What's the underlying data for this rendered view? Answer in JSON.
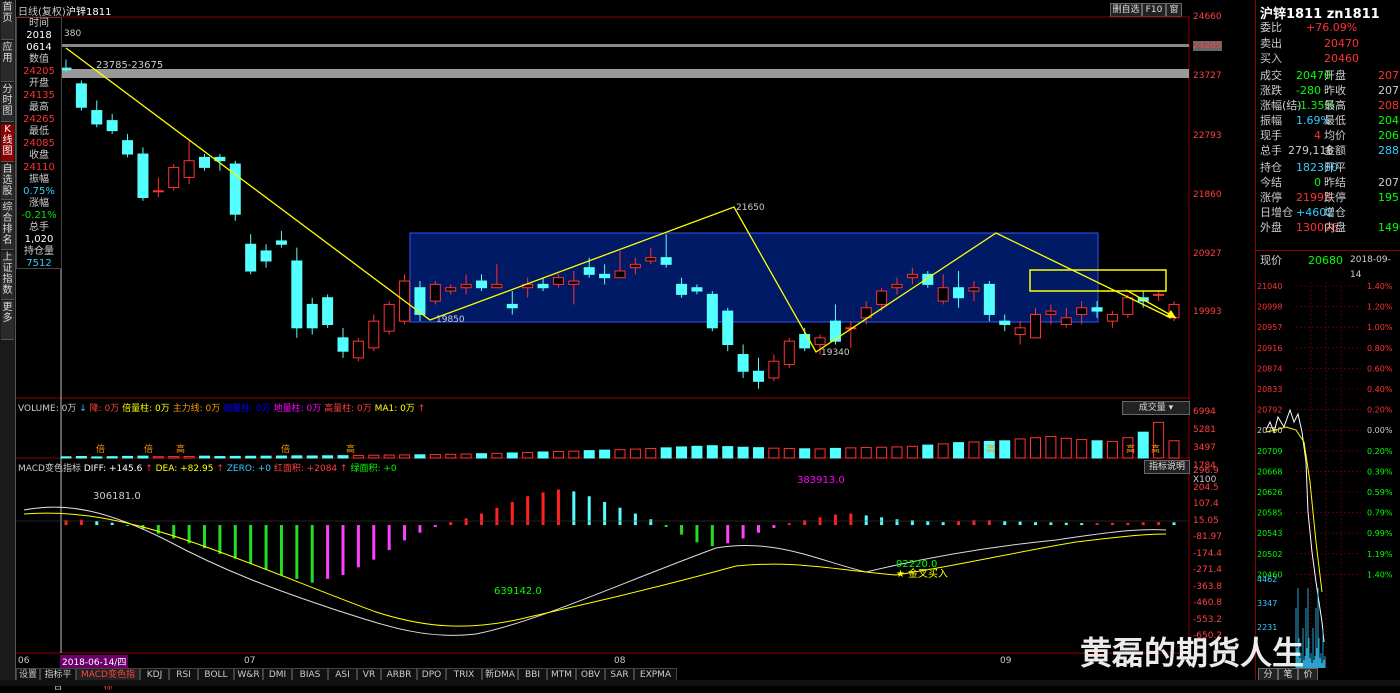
{
  "nav": [
    "首页",
    "应用",
    "分时图",
    "K线图",
    "自选股",
    "综合排名",
    "上证指数",
    "更多"
  ],
  "topbar": {
    "period": "日线(复权)",
    "symbol": "沪锌1811",
    "btn_a": "删自选",
    "btn_b": "F10",
    "btn_c": "窗"
  },
  "infobox": {
    "time_label": "时间",
    "time_value_1": "2018",
    "time_value_2": "0614",
    "val_label": "数值",
    "val_value": "24205",
    "open_label": "开盘",
    "open_value": "24135",
    "high_label": "最高",
    "high_value": "24265",
    "low_label": "最低",
    "low_value": "24085",
    "close_label": "收盘",
    "close_value": "24110",
    "amp_label": "振幅",
    "amp_value": "0.75%",
    "chg_label": "涨幅",
    "chg_value": "-0.21%",
    "vol_label": "总手",
    "vol_value": "1,020",
    "oi_label": "持仓量",
    "oi_value": "7512"
  },
  "annotations": {
    "range": "23785-23675",
    "p19850": "19850",
    "p21650": "21650",
    "p19340": "19340",
    "p380": "380"
  },
  "price_axis": [
    "24660",
    "24205",
    "23727",
    "22793",
    "21860",
    "20927",
    "19993"
  ],
  "volume_axis": [
    "6994",
    "5281",
    "3497",
    "1784",
    "X100"
  ],
  "macd_axis": [
    "296.9",
    "204.5",
    "107.4",
    "15.05",
    "-81.97",
    "-174.4",
    "-271.4",
    "-363.8",
    "-460.8",
    "-553.2",
    "-650.2"
  ],
  "volume_legend": {
    "text": "VOLUME: 0万",
    "a": "降: 0万",
    "b": "倍量柱: 0万",
    "c": "主力线: 0万",
    "d": "缩量柱: 0万",
    "e": "地量柱: 0万",
    "f": "高量柱: 0万",
    "g": "MA1: 0万",
    "selector": "成交量"
  },
  "macd_legend": {
    "name": "MACD变色指标",
    "diff": "DIFF: +145.6",
    "dea": "DEA: +82.95",
    "zero": "ZERO: +0",
    "red_area": "红面积: +2084",
    "green_area": "绿面积: +0",
    "help": "指标说明"
  },
  "macd_annot": {
    "a": "306181.0",
    "b": "383913.0",
    "c": "639142.0",
    "d": "92220.0",
    "cross": "金叉买入"
  },
  "vol_marks": {
    "bei": "倍",
    "gao": "高"
  },
  "xaxis": {
    "m06": "06",
    "date": "2018-06-14/四",
    "m07": "07",
    "m08": "08",
    "m09": "09"
  },
  "tabs": [
    "设置",
    "指标平台",
    "MACD变色指标",
    "KDJ",
    "RSI",
    "BOLL",
    "W&R",
    "DMI",
    "BIAS",
    "ASI",
    "VR",
    "ARBR",
    "DPO",
    "TRIX",
    "新DMA",
    "BBI",
    "MTM",
    "OBV",
    "SAR",
    "EXPMA"
  ],
  "right": {
    "title": "沪锌1811 zn1811",
    "weibi_l": "委比",
    "weibi_v": "+76.09%",
    "sell_l": "卖出",
    "sell_v": "20470",
    "buy_l": "买入",
    "buy_v": "20460",
    "deal_l": "成交",
    "deal_v": "20470",
    "open_l": "开盘",
    "open_v": "207",
    "zd_l": "涨跌",
    "zd_v": "-280",
    "prevc_l": "昨收",
    "prevc_v": "207",
    "zf_l": "涨幅(结)",
    "zf_v": "-1.35%",
    "high_l": "最高",
    "high_v": "208",
    "amp_l": "振幅",
    "amp_v": "1.69%",
    "low_l": "最低",
    "low_v": "204",
    "cur_l": "现手",
    "cur_v": "4",
    "avg_l": "均价",
    "avg_v": "206",
    "tot_l": "总手",
    "tot_v": "279,116",
    "amt_l": "金额",
    "amt_v": "288.7",
    "oi_l": "持仓",
    "oi_v": "182380",
    "ko_l": "开平",
    "ko_v": "",
    "js_l": "今结",
    "js_v": "0",
    "zj_l": "昨结",
    "zj_v": "207",
    "zt_l": "涨停",
    "zt_v": "21995",
    "dt_l": "跌停",
    "dt_v": "195",
    "rzc_l": "日增仓",
    "rzc_v": "+4602",
    "zc_l": "增仓",
    "zc_v": "",
    "wp_l": "外盘",
    "wp_v": "130096",
    "np_l": "内盘",
    "np_v": "1490",
    "now_l": "现价",
    "now_v": "20680",
    "date": "2018-09-14",
    "mini_left": [
      "21040",
      "20998",
      "20957",
      "20916",
      "20874",
      "20833",
      "20792",
      "20750",
      "20709",
      "20668",
      "20626",
      "20585",
      "20543",
      "20502",
      "20460"
    ],
    "mini_right": [
      "1.40%",
      "1.20%",
      "1.00%",
      "0.80%",
      "0.60%",
      "0.40%",
      "0.20%",
      "0.00%",
      "0.20%",
      "0.39%",
      "0.59%",
      "0.79%",
      "0.99%",
      "1.19%",
      "1.40%"
    ],
    "mini_vol": [
      "4462",
      "3347",
      "2231"
    ],
    "tab_a": "分",
    "tab_b": "笔",
    "tab_c": "价"
  },
  "watermark": "黄磊的期货人生",
  "chart_data": {
    "type": "candlestick",
    "title": "沪锌1811 日线(复权)",
    "ylim": [
      19600,
      24700
    ],
    "dates_start": "2018-06-14",
    "candles": [
      [
        24135,
        24265,
        24085,
        24110
      ],
      [
        23900,
        23950,
        23500,
        23550
      ],
      [
        23500,
        23650,
        23250,
        23300
      ],
      [
        23350,
        23450,
        23150,
        23200
      ],
      [
        23050,
        23150,
        22800,
        22850
      ],
      [
        22850,
        22950,
        22150,
        22200
      ],
      [
        22300,
        22500,
        22200,
        22300
      ],
      [
        22350,
        22700,
        22300,
        22650
      ],
      [
        22500,
        23050,
        22400,
        22750
      ],
      [
        22800,
        22850,
        22600,
        22650
      ],
      [
        22800,
        22850,
        22600,
        22750
      ],
      [
        22700,
        22750,
        21850,
        21950
      ],
      [
        21500,
        21650,
        21050,
        21100
      ],
      [
        21400,
        21500,
        21150,
        21250
      ],
      [
        21550,
        21700,
        21450,
        21500
      ],
      [
        21250,
        21450,
        20100,
        20250
      ],
      [
        20600,
        20700,
        20150,
        20250
      ],
      [
        20700,
        20750,
        20250,
        20300
      ],
      [
        20100,
        20250,
        19800,
        19900
      ],
      [
        19800,
        20100,
        19750,
        20050
      ],
      [
        19950,
        20450,
        19900,
        20350
      ],
      [
        20200,
        20650,
        20150,
        20600
      ],
      [
        20350,
        21050,
        20300,
        20950
      ],
      [
        20850,
        20950,
        20350,
        20450
      ],
      [
        20650,
        20950,
        20600,
        20900
      ],
      [
        20800,
        20900,
        20750,
        20850
      ],
      [
        20850,
        21050,
        20750,
        20900
      ],
      [
        20950,
        21050,
        20800,
        20850
      ],
      [
        20850,
        21200,
        20850,
        20900
      ],
      [
        20600,
        20800,
        20450,
        20550
      ],
      [
        20850,
        21000,
        20700,
        20900
      ],
      [
        20900,
        21000,
        20800,
        20850
      ],
      [
        20900,
        21050,
        20850,
        21000
      ],
      [
        20900,
        21100,
        20600,
        20950
      ],
      [
        21150,
        21300,
        21000,
        21050
      ],
      [
        21050,
        21200,
        20900,
        21000
      ],
      [
        21000,
        21400,
        21000,
        21100
      ],
      [
        21150,
        21300,
        21050,
        21200
      ],
      [
        21250,
        21450,
        21200,
        21300
      ],
      [
        21300,
        21650,
        21150,
        21200
      ],
      [
        20900,
        21000,
        20700,
        20750
      ],
      [
        20850,
        20900,
        20750,
        20800
      ],
      [
        20750,
        20800,
        20200,
        20250
      ],
      [
        20500,
        20550,
        19900,
        20000
      ],
      [
        19850,
        20000,
        19500,
        19600
      ],
      [
        19600,
        19800,
        19340,
        19450
      ],
      [
        19500,
        19850,
        19450,
        19750
      ],
      [
        19700,
        20100,
        19650,
        20050
      ],
      [
        20150,
        20250,
        19900,
        19950
      ],
      [
        20000,
        20150,
        19850,
        20100
      ],
      [
        20350,
        20600,
        20000,
        20050
      ],
      [
        20250,
        20350,
        19950,
        20250
      ],
      [
        20400,
        20650,
        20300,
        20550
      ],
      [
        20600,
        20850,
        20500,
        20800
      ],
      [
        20850,
        21000,
        20750,
        20900
      ],
      [
        21000,
        21150,
        20900,
        21050
      ],
      [
        21050,
        21100,
        20850,
        20900
      ],
      [
        20650,
        21050,
        20600,
        20850
      ],
      [
        20850,
        21100,
        20550,
        20700
      ],
      [
        20800,
        20950,
        20650,
        20850
      ],
      [
        20900,
        20950,
        20350,
        20450
      ],
      [
        20350,
        20450,
        20200,
        20300
      ],
      [
        20150,
        20350,
        20000,
        20250
      ],
      [
        20100,
        20550,
        20100,
        20450
      ],
      [
        20450,
        20600,
        20300,
        20500
      ],
      [
        20300,
        20550,
        20250,
        20400
      ],
      [
        20450,
        20650,
        20300,
        20550
      ],
      [
        20550,
        20650,
        20400,
        20500
      ],
      [
        20350,
        20500,
        20250,
        20450
      ],
      [
        20450,
        20750,
        20400,
        20700
      ],
      [
        20700,
        20800,
        20550,
        20650
      ],
      [
        20750,
        20800,
        20650,
        20750
      ],
      [
        20400,
        20650,
        20350,
        20600
      ]
    ],
    "volume_max": 6994,
    "volumes": [
      200,
      250,
      180,
      220,
      260,
      300,
      210,
      230,
      250,
      300,
      240,
      260,
      280,
      300,
      320,
      350,
      330,
      360,
      380,
      420,
      450,
      480,
      500,
      520,
      560,
      600,
      640,
      700,
      760,
      820,
      900,
      980,
      1050,
      1120,
      1200,
      1280,
      1350,
      1450,
      1550,
      1650,
      1800,
      1900,
      2000,
      1850,
      1750,
      1680,
      1600,
      1550,
      1500,
      1480,
      1560,
      1650,
      1700,
      1750,
      1800,
      1900,
      2100,
      2300,
      2500,
      2600,
      2700,
      2800,
      3100,
      3300,
      3500,
      3200,
      3000,
      2800,
      2700,
      3300,
      4200,
      5800,
      2800
    ],
    "macd_hist": [
      25,
      28,
      20,
      12,
      -5,
      -20,
      -45,
      -70,
      -95,
      -120,
      -150,
      -175,
      -200,
      -230,
      -260,
      -280,
      -300,
      -280,
      -260,
      -220,
      -180,
      -130,
      -80,
      -40,
      -10,
      15,
      35,
      60,
      90,
      120,
      150,
      170,
      185,
      175,
      150,
      120,
      90,
      60,
      30,
      -10,
      -50,
      -90,
      -110,
      -95,
      -70,
      -40,
      -15,
      10,
      25,
      40,
      55,
      60,
      50,
      40,
      30,
      25,
      20,
      15,
      20,
      25,
      25,
      20,
      18,
      15,
      14,
      12,
      10,
      10,
      12,
      12,
      14,
      15,
      14
    ],
    "macd_ylim": [
      -650.2,
      296.9
    ]
  }
}
